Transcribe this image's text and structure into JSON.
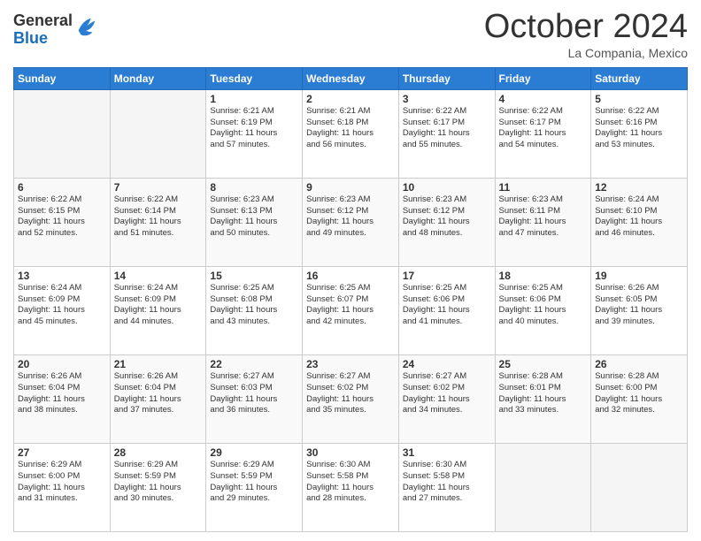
{
  "logo": {
    "general": "General",
    "blue": "Blue"
  },
  "header": {
    "month": "October 2024",
    "location": "La Compania, Mexico"
  },
  "weekdays": [
    "Sunday",
    "Monday",
    "Tuesday",
    "Wednesday",
    "Thursday",
    "Friday",
    "Saturday"
  ],
  "weeks": [
    [
      {
        "day": "",
        "info": ""
      },
      {
        "day": "",
        "info": ""
      },
      {
        "day": "1",
        "info": "Sunrise: 6:21 AM\nSunset: 6:19 PM\nDaylight: 11 hours\nand 57 minutes."
      },
      {
        "day": "2",
        "info": "Sunrise: 6:21 AM\nSunset: 6:18 PM\nDaylight: 11 hours\nand 56 minutes."
      },
      {
        "day": "3",
        "info": "Sunrise: 6:22 AM\nSunset: 6:17 PM\nDaylight: 11 hours\nand 55 minutes."
      },
      {
        "day": "4",
        "info": "Sunrise: 6:22 AM\nSunset: 6:17 PM\nDaylight: 11 hours\nand 54 minutes."
      },
      {
        "day": "5",
        "info": "Sunrise: 6:22 AM\nSunset: 6:16 PM\nDaylight: 11 hours\nand 53 minutes."
      }
    ],
    [
      {
        "day": "6",
        "info": "Sunrise: 6:22 AM\nSunset: 6:15 PM\nDaylight: 11 hours\nand 52 minutes."
      },
      {
        "day": "7",
        "info": "Sunrise: 6:22 AM\nSunset: 6:14 PM\nDaylight: 11 hours\nand 51 minutes."
      },
      {
        "day": "8",
        "info": "Sunrise: 6:23 AM\nSunset: 6:13 PM\nDaylight: 11 hours\nand 50 minutes."
      },
      {
        "day": "9",
        "info": "Sunrise: 6:23 AM\nSunset: 6:12 PM\nDaylight: 11 hours\nand 49 minutes."
      },
      {
        "day": "10",
        "info": "Sunrise: 6:23 AM\nSunset: 6:12 PM\nDaylight: 11 hours\nand 48 minutes."
      },
      {
        "day": "11",
        "info": "Sunrise: 6:23 AM\nSunset: 6:11 PM\nDaylight: 11 hours\nand 47 minutes."
      },
      {
        "day": "12",
        "info": "Sunrise: 6:24 AM\nSunset: 6:10 PM\nDaylight: 11 hours\nand 46 minutes."
      }
    ],
    [
      {
        "day": "13",
        "info": "Sunrise: 6:24 AM\nSunset: 6:09 PM\nDaylight: 11 hours\nand 45 minutes."
      },
      {
        "day": "14",
        "info": "Sunrise: 6:24 AM\nSunset: 6:09 PM\nDaylight: 11 hours\nand 44 minutes."
      },
      {
        "day": "15",
        "info": "Sunrise: 6:25 AM\nSunset: 6:08 PM\nDaylight: 11 hours\nand 43 minutes."
      },
      {
        "day": "16",
        "info": "Sunrise: 6:25 AM\nSunset: 6:07 PM\nDaylight: 11 hours\nand 42 minutes."
      },
      {
        "day": "17",
        "info": "Sunrise: 6:25 AM\nSunset: 6:06 PM\nDaylight: 11 hours\nand 41 minutes."
      },
      {
        "day": "18",
        "info": "Sunrise: 6:25 AM\nSunset: 6:06 PM\nDaylight: 11 hours\nand 40 minutes."
      },
      {
        "day": "19",
        "info": "Sunrise: 6:26 AM\nSunset: 6:05 PM\nDaylight: 11 hours\nand 39 minutes."
      }
    ],
    [
      {
        "day": "20",
        "info": "Sunrise: 6:26 AM\nSunset: 6:04 PM\nDaylight: 11 hours\nand 38 minutes."
      },
      {
        "day": "21",
        "info": "Sunrise: 6:26 AM\nSunset: 6:04 PM\nDaylight: 11 hours\nand 37 minutes."
      },
      {
        "day": "22",
        "info": "Sunrise: 6:27 AM\nSunset: 6:03 PM\nDaylight: 11 hours\nand 36 minutes."
      },
      {
        "day": "23",
        "info": "Sunrise: 6:27 AM\nSunset: 6:02 PM\nDaylight: 11 hours\nand 35 minutes."
      },
      {
        "day": "24",
        "info": "Sunrise: 6:27 AM\nSunset: 6:02 PM\nDaylight: 11 hours\nand 34 minutes."
      },
      {
        "day": "25",
        "info": "Sunrise: 6:28 AM\nSunset: 6:01 PM\nDaylight: 11 hours\nand 33 minutes."
      },
      {
        "day": "26",
        "info": "Sunrise: 6:28 AM\nSunset: 6:00 PM\nDaylight: 11 hours\nand 32 minutes."
      }
    ],
    [
      {
        "day": "27",
        "info": "Sunrise: 6:29 AM\nSunset: 6:00 PM\nDaylight: 11 hours\nand 31 minutes."
      },
      {
        "day": "28",
        "info": "Sunrise: 6:29 AM\nSunset: 5:59 PM\nDaylight: 11 hours\nand 30 minutes."
      },
      {
        "day": "29",
        "info": "Sunrise: 6:29 AM\nSunset: 5:59 PM\nDaylight: 11 hours\nand 29 minutes."
      },
      {
        "day": "30",
        "info": "Sunrise: 6:30 AM\nSunset: 5:58 PM\nDaylight: 11 hours\nand 28 minutes."
      },
      {
        "day": "31",
        "info": "Sunrise: 6:30 AM\nSunset: 5:58 PM\nDaylight: 11 hours\nand 27 minutes."
      },
      {
        "day": "",
        "info": ""
      },
      {
        "day": "",
        "info": ""
      }
    ]
  ]
}
